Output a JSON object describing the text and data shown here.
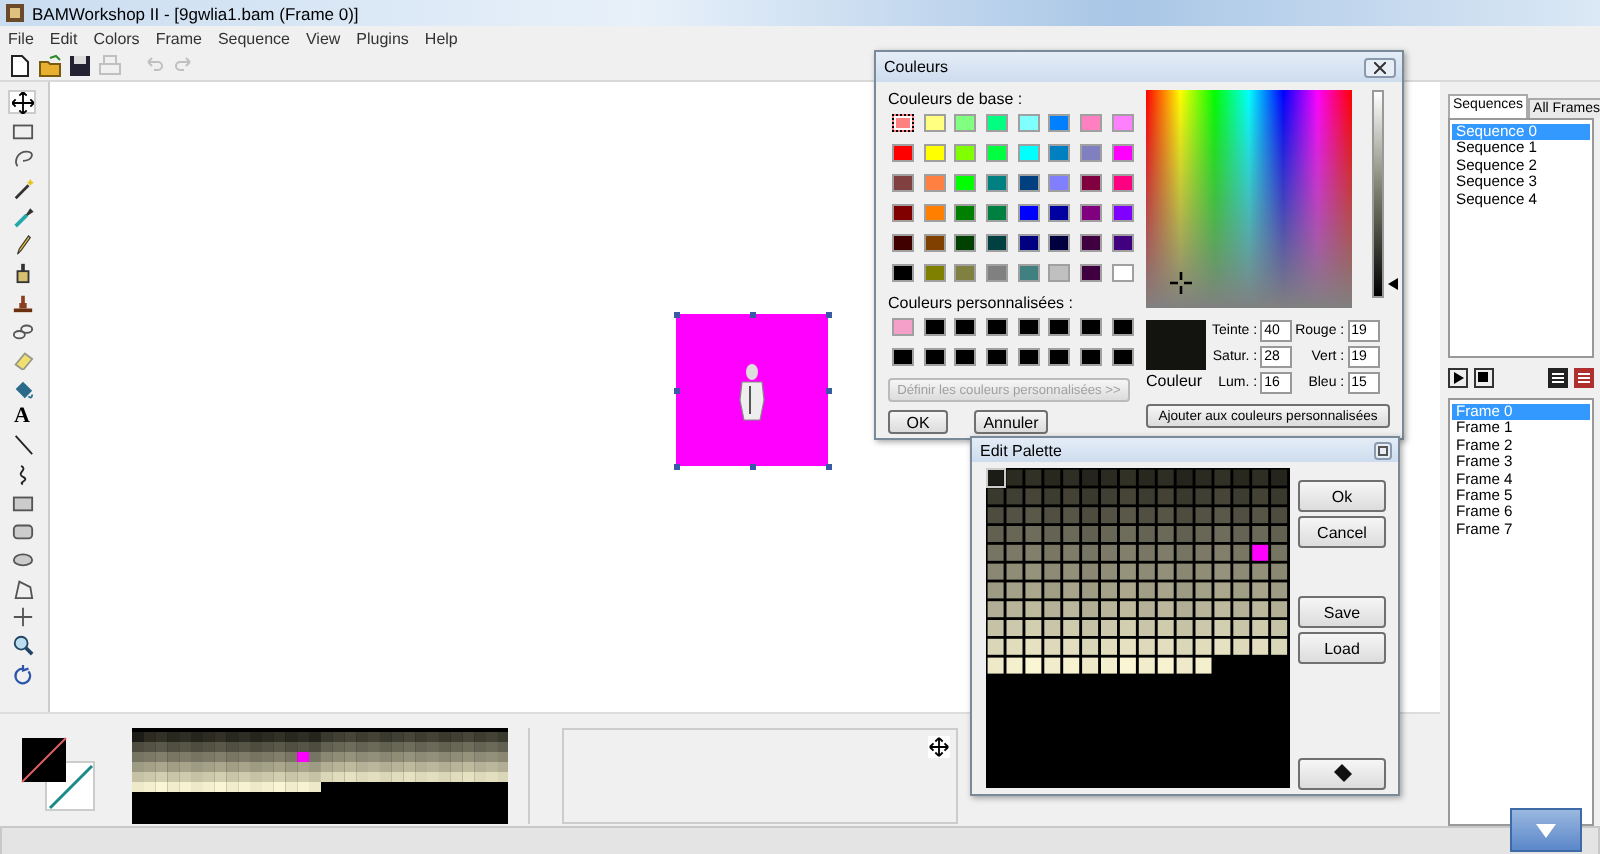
{
  "window": {
    "title": "BAMWorkshop II - [9gwlia1.bam (Frame 0)]"
  },
  "menu": [
    "File",
    "Edit",
    "Colors",
    "Frame",
    "Sequence",
    "View",
    "Plugins",
    "Help"
  ],
  "toolbar": [
    {
      "disabled": false
    },
    {
      "disabled": false
    },
    {
      "disabled": false
    },
    {
      "disabled": true
    },
    {
      "disabled": true
    },
    {
      "disabled": true
    }
  ],
  "tools": [
    {
      "selected": true
    },
    {
      "selected": false
    },
    {
      "selected": false
    },
    {
      "selected": false
    },
    {
      "selected": false
    },
    {
      "selected": false
    },
    {
      "selected": false
    },
    {
      "selected": false
    },
    {
      "selected": false
    },
    {
      "selected": false
    },
    {
      "selected": false
    },
    {
      "selected": false,
      "glyph": "A"
    },
    {
      "selected": false
    },
    {
      "selected": false
    },
    {
      "selected": false
    },
    {
      "selected": false
    },
    {
      "selected": false
    },
    {
      "selected": false
    },
    {
      "selected": false
    },
    {
      "selected": false
    },
    {
      "selected": false
    }
  ],
  "side_panel": {
    "tabs": [
      {
        "label": "Sequences",
        "selected": true
      },
      {
        "label": "All Frames",
        "selected": false
      }
    ],
    "sequences": [
      {
        "label": "Sequence 0",
        "selected": true
      },
      {
        "label": "Sequence 1",
        "selected": false
      },
      {
        "label": "Sequence 2",
        "selected": false
      },
      {
        "label": "Sequence 3",
        "selected": false
      },
      {
        "label": "Sequence 4",
        "selected": false
      }
    ],
    "frames": [
      {
        "label": "Frame 0",
        "selected": true
      },
      {
        "label": "Frame 1",
        "selected": false
      },
      {
        "label": "Frame 2",
        "selected": false
      },
      {
        "label": "Frame 3",
        "selected": false
      },
      {
        "label": "Frame 4",
        "selected": false
      },
      {
        "label": "Frame 5",
        "selected": false
      },
      {
        "label": "Frame 6",
        "selected": false
      },
      {
        "label": "Frame 7",
        "selected": false
      }
    ]
  },
  "color_dialog": {
    "title": "Couleurs",
    "base_label": "Couleurs de base :",
    "base_colors": [
      {
        "color": "#ff8080",
        "selected": true
      },
      {
        "color": "#ffff80",
        "selected": false
      },
      {
        "color": "#80ff80",
        "selected": false
      },
      {
        "color": "#00ff80",
        "selected": false
      },
      {
        "color": "#80ffff",
        "selected": false
      },
      {
        "color": "#0080ff",
        "selected": false
      },
      {
        "color": "#ff80c0",
        "selected": false
      },
      {
        "color": "#ff80ff",
        "selected": false
      },
      {
        "color": "#ff0000",
        "selected": false
      },
      {
        "color": "#ffff00",
        "selected": false
      },
      {
        "color": "#80ff00",
        "selected": false
      },
      {
        "color": "#00ff40",
        "selected": false
      },
      {
        "color": "#00ffff",
        "selected": false
      },
      {
        "color": "#0080c0",
        "selected": false
      },
      {
        "color": "#8080c0",
        "selected": false
      },
      {
        "color": "#ff00ff",
        "selected": false
      },
      {
        "color": "#804040",
        "selected": false
      },
      {
        "color": "#ff8040",
        "selected": false
      },
      {
        "color": "#00ff00",
        "selected": false
      },
      {
        "color": "#008080",
        "selected": false
      },
      {
        "color": "#004080",
        "selected": false
      },
      {
        "color": "#8080ff",
        "selected": false
      },
      {
        "color": "#800040",
        "selected": false
      },
      {
        "color": "#ff0080",
        "selected": false
      },
      {
        "color": "#800000",
        "selected": false
      },
      {
        "color": "#ff8000",
        "selected": false
      },
      {
        "color": "#008000",
        "selected": false
      },
      {
        "color": "#008040",
        "selected": false
      },
      {
        "color": "#0000ff",
        "selected": false
      },
      {
        "color": "#0000a0",
        "selected": false
      },
      {
        "color": "#800080",
        "selected": false
      },
      {
        "color": "#8000ff",
        "selected": false
      },
      {
        "color": "#400000",
        "selected": false
      },
      {
        "color": "#804000",
        "selected": false
      },
      {
        "color": "#004000",
        "selected": false
      },
      {
        "color": "#004040",
        "selected": false
      },
      {
        "color": "#000080",
        "selected": false
      },
      {
        "color": "#000040",
        "selected": false
      },
      {
        "color": "#400040",
        "selected": false
      },
      {
        "color": "#400080",
        "selected": false
      },
      {
        "color": "#000000",
        "selected": false
      },
      {
        "color": "#808000",
        "selected": false
      },
      {
        "color": "#808040",
        "selected": false
      },
      {
        "color": "#808080",
        "selected": false
      },
      {
        "color": "#408080",
        "selected": false
      },
      {
        "color": "#c0c0c0",
        "selected": false
      },
      {
        "color": "#400040",
        "selected": false
      },
      {
        "color": "#ffffff",
        "selected": false
      }
    ],
    "custom_label": "Couleurs personnalisées :",
    "custom_colors": [
      {
        "color": "#f4a0c8"
      },
      {
        "color": "#000000"
      },
      {
        "color": "#000000"
      },
      {
        "color": "#000000"
      },
      {
        "color": "#000000"
      },
      {
        "color": "#000000"
      },
      {
        "color": "#000000"
      },
      {
        "color": "#000000"
      },
      {
        "color": "#000000"
      },
      {
        "color": "#000000"
      },
      {
        "color": "#000000"
      },
      {
        "color": "#000000"
      },
      {
        "color": "#000000"
      },
      {
        "color": "#000000"
      },
      {
        "color": "#000000"
      },
      {
        "color": "#000000"
      }
    ],
    "define_button": {
      "label": "Définir les couleurs personnalisées >>",
      "disabled": true
    },
    "ok": "OK",
    "cancel": "Annuler",
    "luminosity": {
      "level": 0.07
    },
    "current_color": {
      "color": "#13130f",
      "label": "Couleur"
    },
    "fields": [
      {
        "label": "Teinte :",
        "value": "40"
      },
      {
        "label": "Rouge :",
        "value": "19"
      },
      {
        "label": "Satur. :",
        "value": "28"
      },
      {
        "label": "Vert :",
        "value": "19"
      },
      {
        "label": "Lum. :",
        "value": "16"
      },
      {
        "label": "Bleu :",
        "value": "15"
      }
    ],
    "add_button": "Ajouter aux couleurs personnalisées"
  },
  "palette_dialog": {
    "title": "Edit Palette",
    "buttons": [
      "Ok",
      "Cancel",
      "Save",
      "Load"
    ]
  }
}
